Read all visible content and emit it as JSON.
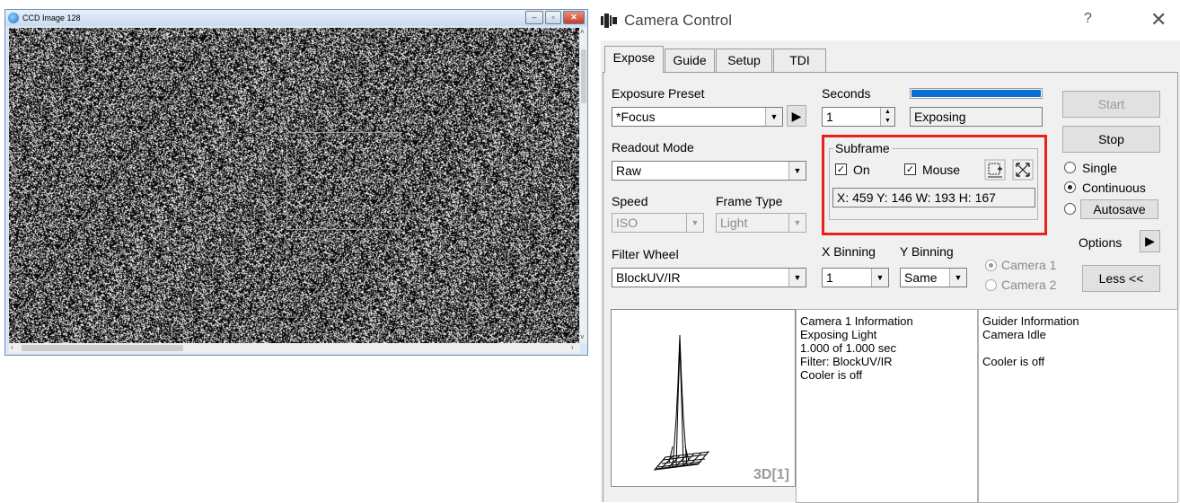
{
  "ccd_window": {
    "title": "CCD Image 128",
    "buttons": [
      "‒",
      "▫",
      "✕"
    ]
  },
  "camera_window": {
    "title": "Camera Control",
    "help": "?",
    "close": "✕",
    "tabs": [
      "Expose",
      "Guide",
      "Setup",
      "TDI"
    ],
    "exposure_preset": {
      "label": "Exposure Preset",
      "value": "*Focus"
    },
    "seconds": {
      "label": "Seconds",
      "value": "1",
      "status": "Exposing",
      "progress": 1.0
    },
    "readout_mode": {
      "label": "Readout Mode",
      "value": "Raw"
    },
    "speed": {
      "label": "Speed",
      "value": "ISO"
    },
    "frame_type": {
      "label": "Frame Type",
      "value": "Light"
    },
    "filter_wheel": {
      "label": "Filter Wheel",
      "value": "BlockUV/IR"
    },
    "subframe": {
      "label": "Subframe",
      "on_label": "On",
      "mouse_label": "Mouse",
      "coords": "X: 459 Y: 146 W: 193 H: 167",
      "on_checked": true,
      "mouse_checked": true
    },
    "x_binning": {
      "label": "X Binning",
      "value": "1"
    },
    "y_binning": {
      "label": "Y Binning",
      "value": "Same"
    },
    "camera_select": {
      "camera1": "Camera 1",
      "camera2": "Camera 2"
    },
    "buttons": {
      "start": "Start",
      "stop": "Stop",
      "autosave": "Autosave",
      "options": "Options",
      "less": "Less <<"
    },
    "mode": {
      "single": "Single",
      "continuous": "Continuous"
    },
    "plot_label": "3D[1]",
    "camera_info": "Camera 1 Information\nExposing Light\n1.000 of 1.000 sec\nFilter: BlockUV/IR\nCooler is off",
    "guider_info": "Guider Information\nCamera Idle\n\nCooler is off"
  },
  "colors": {
    "progress": "#0a6fd4",
    "highlight": "#e8221c",
    "panel": "#f0f0f0"
  }
}
